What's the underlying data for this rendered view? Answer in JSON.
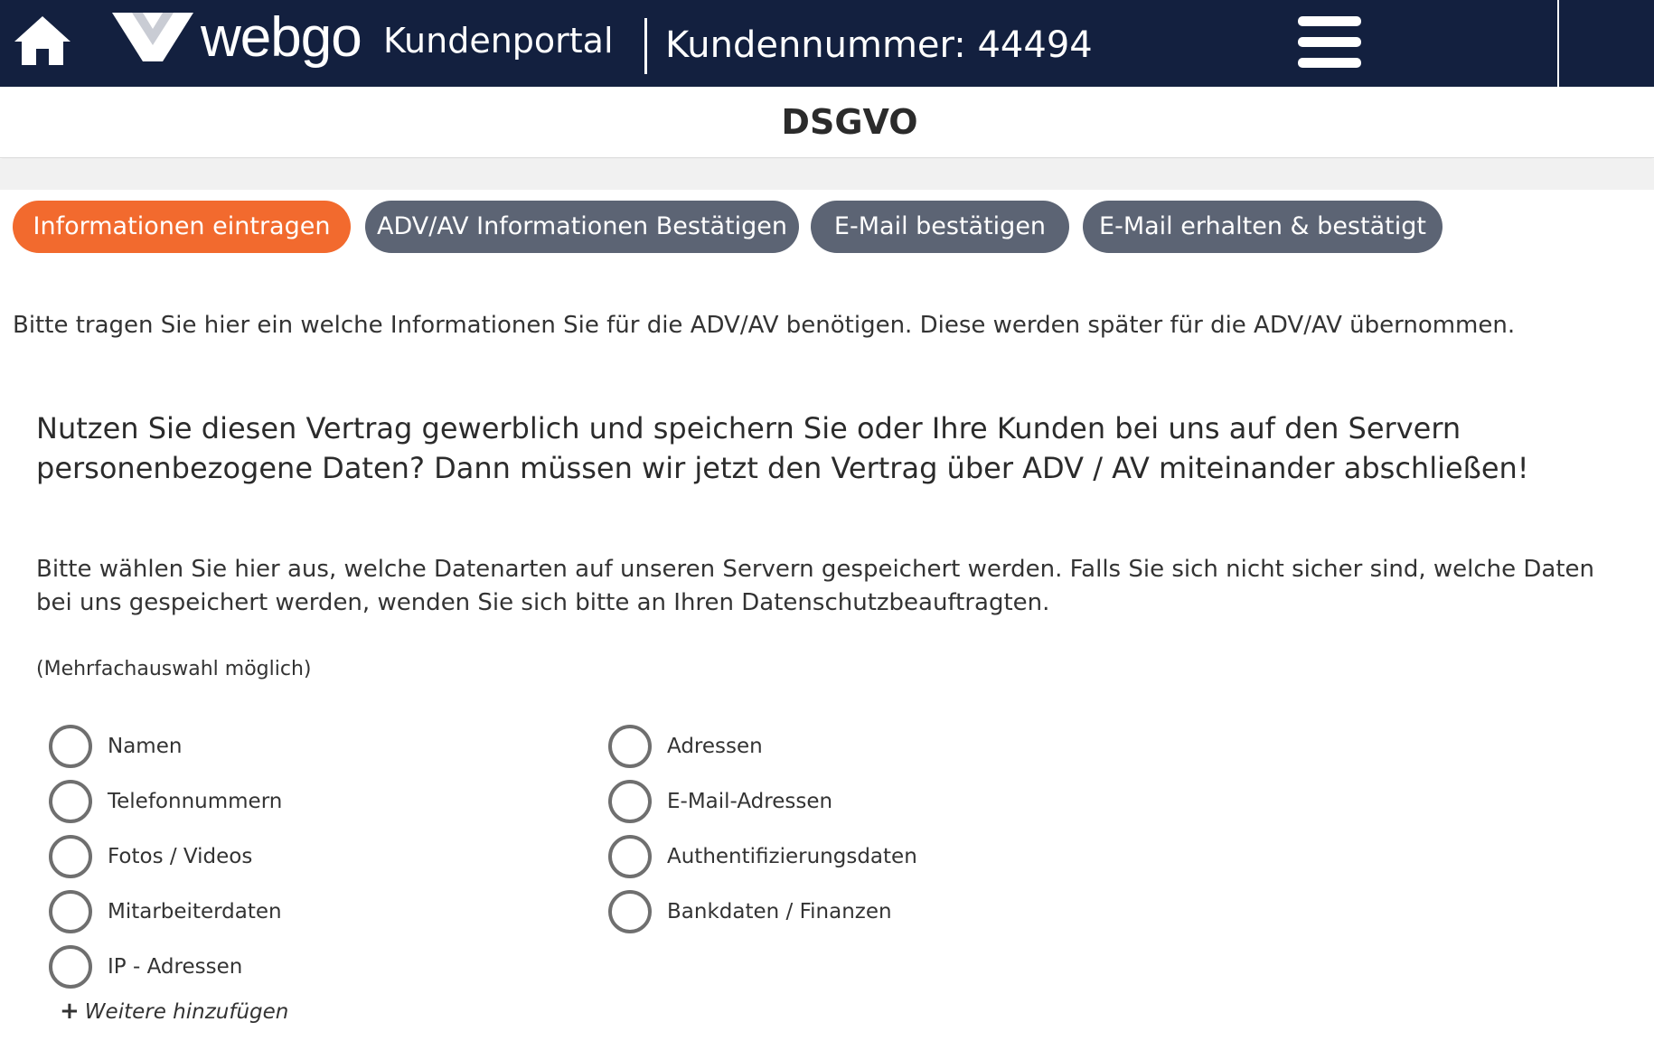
{
  "header": {
    "brand": "webgo",
    "portal": "Kundenportal",
    "customer_number": "Kundennummer: 44494",
    "home_icon": "home-icon",
    "menu_icon": "hamburger-menu-icon",
    "background_color": "#13203f"
  },
  "page": {
    "title": "DSGVO"
  },
  "steps": [
    {
      "label": "Informationen eintragen",
      "state": "active"
    },
    {
      "label": "ADV/AV Informationen Bestätigen",
      "state": "inactive"
    },
    {
      "label": "E-Mail bestätigen",
      "state": "inactive"
    },
    {
      "label": "E-Mail erhalten & bestätigt",
      "state": "inactive"
    }
  ],
  "colors": {
    "active_step": "#f26a2e",
    "inactive_step": "#5c6474"
  },
  "content": {
    "intro": "Bitte tragen Sie hier ein welche Informationen Sie für die ADV/AV benötigen. Diese werden später für die ADV/AV übernommen.",
    "headline": "Nutzen Sie diesen Vertrag gewerblich und speichern Sie oder Ihre Kunden bei uns auf den Servern personenbezogene Daten? Dann müssen wir jetzt den Vertrag über ADV / AV miteinander abschließen!",
    "instruction": "Bitte wählen Sie hier aus, welche Datenarten auf unseren Servern gespeichert werden. Falls Sie sich nicht sicher sind, welche Daten bei uns gespeichert werden, wenden Sie sich bitte an Ihren Datenschutzbeauftragten.",
    "multi_note": "(Mehrfachauswahl möglich)"
  },
  "options": {
    "left": [
      "Namen",
      "Telefonnummern",
      "Fotos / Videos",
      "Mitarbeiterdaten",
      "IP - Adressen"
    ],
    "right": [
      "Adressen",
      "E-Mail-Adressen",
      "Authentifizierungsdaten",
      "Bankdaten / Finanzen"
    ]
  },
  "add_more": {
    "label": "Weitere hinzufügen",
    "icon": "plus-icon"
  }
}
